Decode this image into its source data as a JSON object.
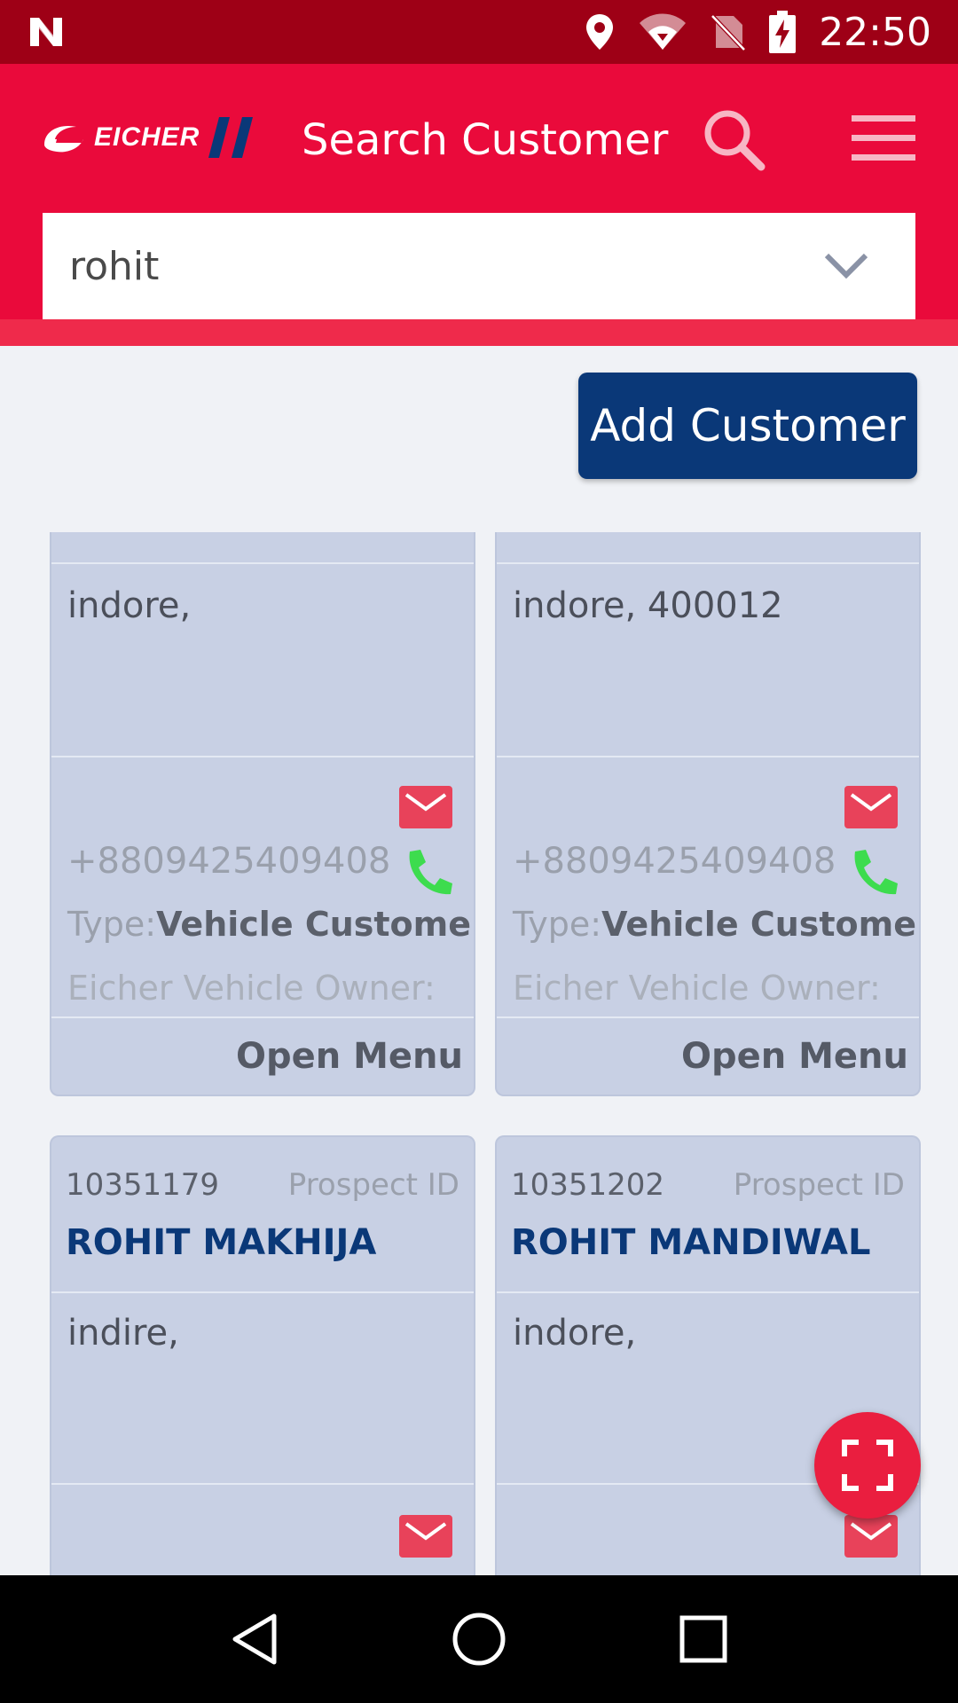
{
  "status_bar": {
    "time": "22:50",
    "icons": [
      "notification-n-icon",
      "location-icon",
      "wifi-icon",
      "no-sim-icon",
      "battery-charging-icon"
    ]
  },
  "header": {
    "logo_text": "EICHER",
    "title": "Search Customer",
    "search_icon": "search-icon",
    "menu_icon": "hamburger-menu-icon"
  },
  "search": {
    "value": "rohit"
  },
  "actions": {
    "add_customer": "Add Customer"
  },
  "cards_top": [
    {
      "address": "indore,",
      "phone": "+8809425409408",
      "type_label": "Type:",
      "type_value": "Vehicle Customer",
      "owner_label": "Eicher Vehicle Owner:",
      "open_menu": "Open Menu"
    },
    {
      "address": "indore, 400012",
      "phone": "+8809425409408",
      "type_label": "Type:",
      "type_value": "Vehicle Customer",
      "owner_label": "Eicher Vehicle Owner:",
      "open_menu": "Open Menu"
    }
  ],
  "cards_bottom": [
    {
      "id": "10351179",
      "id_label": "Prospect ID",
      "name": "ROHIT MAKHIJA",
      "address": "indire,"
    },
    {
      "id": "10351202",
      "id_label": "Prospect ID",
      "name": "ROHIT MANDIWAL",
      "address": "indore,"
    }
  ],
  "colors": {
    "status_bar": "#9e0016",
    "header": "#ea0a3b",
    "primary_button": "#0a3878",
    "card": "#c8d0e4",
    "mail": "#e8425a",
    "phone": "#3ddc4e",
    "fab": "#ea1e3f"
  }
}
